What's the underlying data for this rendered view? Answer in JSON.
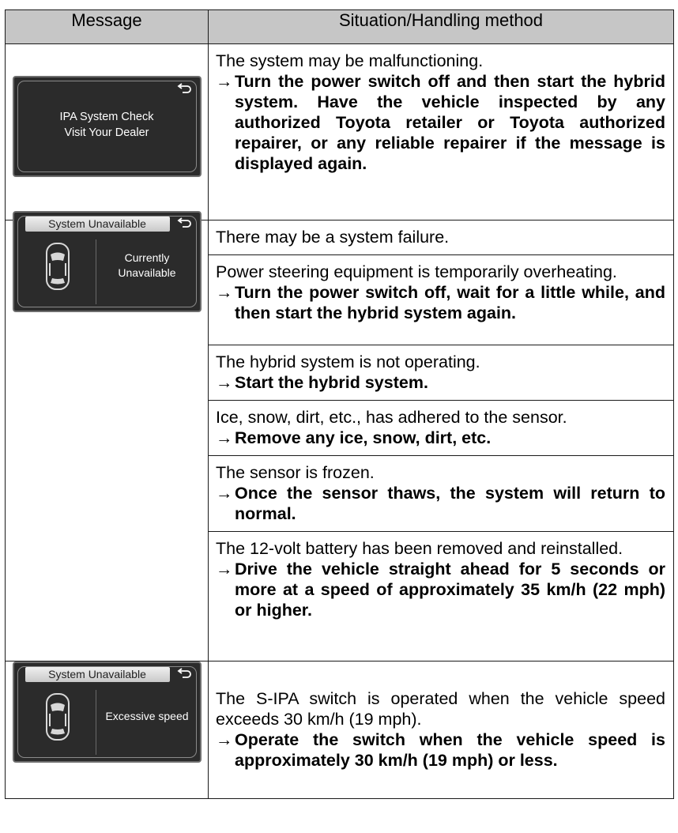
{
  "header": {
    "col_message": "Message",
    "col_situation": "Situation/Handling method"
  },
  "screens": {
    "ipa_check": {
      "line1": "IPA System Check",
      "line2": "Visit Your Dealer"
    },
    "unavailable_1": {
      "banner": "System Unavailable",
      "side_line1": "Currently",
      "side_line2": "Unavailable"
    },
    "unavailable_2": {
      "banner": "System Unavailable",
      "side_line1": "Excessive speed"
    }
  },
  "rows": {
    "r1": {
      "situation": "The system may be malfunctioning.",
      "arrow": "→",
      "handling": "Turn the power switch off and then start the hybrid system. Have the vehicle inspected by any authorized Toyota retailer or Toyota authorized repairer, or any reliable repairer if the message is displayed again."
    },
    "r2a": {
      "situation": "There may be a system failure."
    },
    "r2b": {
      "situation": "Power steering equipment is temporarily overheating.",
      "arrow": "→",
      "handling": "Turn the power switch off, wait for a little while, and then start the hybrid system again."
    },
    "r2c": {
      "situation": "The hybrid system is not operating.",
      "arrow": "→",
      "handling": "Start the hybrid system."
    },
    "r2d": {
      "situation": "Ice, snow, dirt, etc., has adhered to the sensor.",
      "arrow": "→",
      "handling": "Remove any ice, snow, dirt, etc."
    },
    "r2e": {
      "situation": "The sensor is frozen.",
      "arrow": "→",
      "handling": "Once the sensor thaws, the system will return to normal."
    },
    "r2f": {
      "situation": "The 12-volt battery has been removed and reinstalled.",
      "arrow": "→",
      "handling": "Drive the vehicle straight ahead for 5 seconds or more at a speed of approximately 35 km/h (22 mph) or higher."
    },
    "r3": {
      "situation": "The S-IPA switch is operated when the vehicle speed exceeds 30 km/h (19 mph).",
      "arrow": "→",
      "handling": "Operate the switch when the vehicle speed is approximately 30 km/h (19 mph) or less."
    }
  },
  "icons": [
    "return-arrow-icon",
    "car-top-view-icon"
  ],
  "colors": {
    "header_bg": "#c6c6c6",
    "screen_bg": "#2b2b2b",
    "banner_bg": "#e0e0e0"
  }
}
